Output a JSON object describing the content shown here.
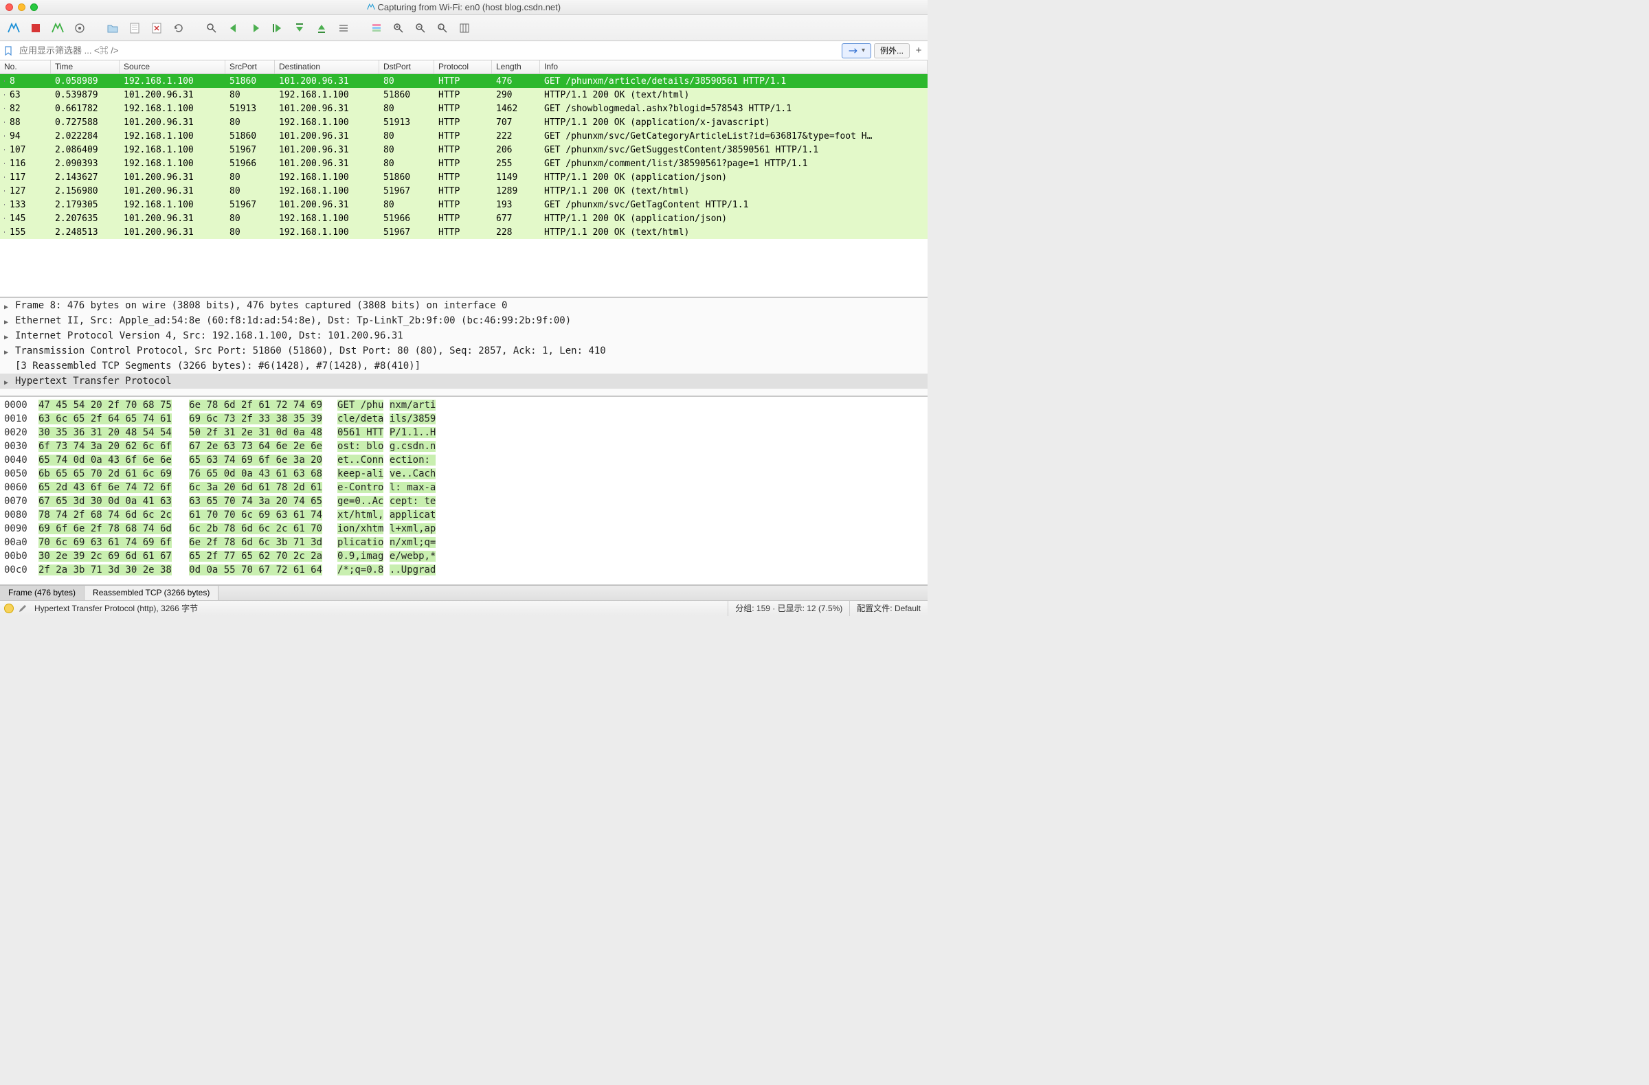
{
  "window": {
    "title": "Capturing from Wi-Fi: en0 (host blog.csdn.net)"
  },
  "filter": {
    "placeholder": "应用显示筛选器 ... <⌘ />",
    "arrow_label": "→",
    "expr_label": "例外...",
    "add_label": "+"
  },
  "columns": {
    "no": "No.",
    "time": "Time",
    "source": "Source",
    "srcport": "SrcPort",
    "destination": "Destination",
    "dstport": "DstPort",
    "protocol": "Protocol",
    "length": "Length",
    "info": "Info"
  },
  "packets": [
    {
      "no": "8",
      "time": "0.058989",
      "src": "192.168.1.100",
      "sport": "51860",
      "dst": "101.200.96.31",
      "dport": "80",
      "proto": "HTTP",
      "len": "476",
      "info": "GET /phunxm/article/details/38590561 HTTP/1.1",
      "sel": true
    },
    {
      "no": "63",
      "time": "0.539879",
      "src": "101.200.96.31",
      "sport": "80",
      "dst": "192.168.1.100",
      "dport": "51860",
      "proto": "HTTP",
      "len": "290",
      "info": "HTTP/1.1 200 OK  (text/html)"
    },
    {
      "no": "82",
      "time": "0.661782",
      "src": "192.168.1.100",
      "sport": "51913",
      "dst": "101.200.96.31",
      "dport": "80",
      "proto": "HTTP",
      "len": "1462",
      "info": "GET /showblogmedal.ashx?blogid=578543 HTTP/1.1"
    },
    {
      "no": "88",
      "time": "0.727588",
      "src": "101.200.96.31",
      "sport": "80",
      "dst": "192.168.1.100",
      "dport": "51913",
      "proto": "HTTP",
      "len": "707",
      "info": "HTTP/1.1 200 OK  (application/x-javascript)"
    },
    {
      "no": "94",
      "time": "2.022284",
      "src": "192.168.1.100",
      "sport": "51860",
      "dst": "101.200.96.31",
      "dport": "80",
      "proto": "HTTP",
      "len": "222",
      "info": "GET /phunxm/svc/GetCategoryArticleList?id=636817&type=foot H…"
    },
    {
      "no": "107",
      "time": "2.086409",
      "src": "192.168.1.100",
      "sport": "51967",
      "dst": "101.200.96.31",
      "dport": "80",
      "proto": "HTTP",
      "len": "206",
      "info": "GET /phunxm/svc/GetSuggestContent/38590561 HTTP/1.1"
    },
    {
      "no": "116",
      "time": "2.090393",
      "src": "192.168.1.100",
      "sport": "51966",
      "dst": "101.200.96.31",
      "dport": "80",
      "proto": "HTTP",
      "len": "255",
      "info": "GET /phunxm/comment/list/38590561?page=1 HTTP/1.1"
    },
    {
      "no": "117",
      "time": "2.143627",
      "src": "101.200.96.31",
      "sport": "80",
      "dst": "192.168.1.100",
      "dport": "51860",
      "proto": "HTTP",
      "len": "1149",
      "info": "HTTP/1.1 200 OK  (application/json)"
    },
    {
      "no": "127",
      "time": "2.156980",
      "src": "101.200.96.31",
      "sport": "80",
      "dst": "192.168.1.100",
      "dport": "51967",
      "proto": "HTTP",
      "len": "1289",
      "info": "HTTP/1.1 200 OK  (text/html)"
    },
    {
      "no": "133",
      "time": "2.179305",
      "src": "192.168.1.100",
      "sport": "51967",
      "dst": "101.200.96.31",
      "dport": "80",
      "proto": "HTTP",
      "len": "193",
      "info": "GET /phunxm/svc/GetTagContent HTTP/1.1"
    },
    {
      "no": "145",
      "time": "2.207635",
      "src": "101.200.96.31",
      "sport": "80",
      "dst": "192.168.1.100",
      "dport": "51966",
      "proto": "HTTP",
      "len": "677",
      "info": "HTTP/1.1 200 OK  (application/json)"
    },
    {
      "no": "155",
      "time": "2.248513",
      "src": "101.200.96.31",
      "sport": "80",
      "dst": "192.168.1.100",
      "dport": "51967",
      "proto": "HTTP",
      "len": "228",
      "info": "HTTP/1.1 200 OK  (text/html)"
    }
  ],
  "details": [
    {
      "text": "Frame 8: 476 bytes on wire (3808 bits), 476 bytes captured (3808 bits) on interface 0",
      "hl": false,
      "exp": true
    },
    {
      "text": "Ethernet II, Src: Apple_ad:54:8e (60:f8:1d:ad:54:8e), Dst: Tp-LinkT_2b:9f:00 (bc:46:99:2b:9f:00)",
      "hl": false,
      "exp": true
    },
    {
      "text": "Internet Protocol Version 4, Src: 192.168.1.100, Dst: 101.200.96.31",
      "hl": false,
      "exp": true
    },
    {
      "text": "Transmission Control Protocol, Src Port: 51860 (51860), Dst Port: 80 (80), Seq: 2857, Ack: 1, Len: 410",
      "hl": false,
      "exp": true
    },
    {
      "text": "[3 Reassembled TCP Segments (3266 bytes): #6(1428), #7(1428), #8(410)]",
      "hl": false,
      "exp": false
    },
    {
      "text": "Hypertext Transfer Protocol",
      "hl": true,
      "exp": true
    }
  ],
  "hex": [
    {
      "off": "0000",
      "b1": "47 45 54 20 2f 70 68 75",
      "b2": "6e 78 6d 2f 61 72 74 69",
      "a1": "GET /phu",
      "a2": "nxm/arti"
    },
    {
      "off": "0010",
      "b1": "63 6c 65 2f 64 65 74 61",
      "b2": "69 6c 73 2f 33 38 35 39",
      "a1": "cle/deta",
      "a2": "ils/3859"
    },
    {
      "off": "0020",
      "b1": "30 35 36 31 20 48 54 54",
      "b2": "50 2f 31 2e 31 0d 0a 48",
      "a1": "0561 HTT",
      "a2": "P/1.1..H"
    },
    {
      "off": "0030",
      "b1": "6f 73 74 3a 20 62 6c 6f",
      "b2": "67 2e 63 73 64 6e 2e 6e",
      "a1": "ost: blo",
      "a2": "g.csdn.n"
    },
    {
      "off": "0040",
      "b1": "65 74 0d 0a 43 6f 6e 6e",
      "b2": "65 63 74 69 6f 6e 3a 20",
      "a1": "et..Conn",
      "a2": "ection: "
    },
    {
      "off": "0050",
      "b1": "6b 65 65 70 2d 61 6c 69",
      "b2": "76 65 0d 0a 43 61 63 68",
      "a1": "keep-ali",
      "a2": "ve..Cach"
    },
    {
      "off": "0060",
      "b1": "65 2d 43 6f 6e 74 72 6f",
      "b2": "6c 3a 20 6d 61 78 2d 61",
      "a1": "e-Contro",
      "a2": "l: max-a"
    },
    {
      "off": "0070",
      "b1": "67 65 3d 30 0d 0a 41 63",
      "b2": "63 65 70 74 3a 20 74 65",
      "a1": "ge=0..Ac",
      "a2": "cept: te"
    },
    {
      "off": "0080",
      "b1": "78 74 2f 68 74 6d 6c 2c",
      "b2": "61 70 70 6c 69 63 61 74",
      "a1": "xt/html,",
      "a2": "applicat"
    },
    {
      "off": "0090",
      "b1": "69 6f 6e 2f 78 68 74 6d",
      "b2": "6c 2b 78 6d 6c 2c 61 70",
      "a1": "ion/xhtm",
      "a2": "l+xml,ap"
    },
    {
      "off": "00a0",
      "b1": "70 6c 69 63 61 74 69 6f",
      "b2": "6e 2f 78 6d 6c 3b 71 3d",
      "a1": "plicatio",
      "a2": "n/xml;q="
    },
    {
      "off": "00b0",
      "b1": "30 2e 39 2c 69 6d 61 67",
      "b2": "65 2f 77 65 62 70 2c 2a",
      "a1": "0.9,imag",
      "a2": "e/webp,*"
    },
    {
      "off": "00c0",
      "b1": "2f 2a 3b 71 3d 30 2e 38",
      "b2": "0d 0a 55 70 67 72 61 64",
      "a1": "/*;q=0.8",
      "a2": "..Upgrad"
    }
  ],
  "hextabs": {
    "frame": "Frame (476 bytes)",
    "reasm": "Reassembled TCP (3266 bytes)"
  },
  "status": {
    "left": "Hypertext Transfer Protocol (http), 3266 字节",
    "mid": "分组: 159 · 已显示: 12 (7.5%)",
    "right": "配置文件: Default"
  }
}
